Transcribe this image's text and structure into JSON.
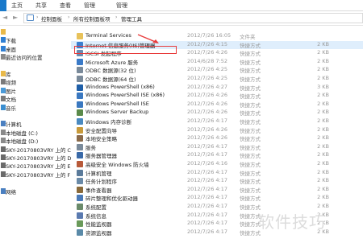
{
  "ribbon": {
    "tabs": [
      "主页",
      "共享",
      "查看",
      "管理",
      "管理"
    ]
  },
  "address": {
    "crumbs": [
      "控制面板",
      "所有控制面板项",
      "管理工具"
    ]
  },
  "nav": [
    {
      "label": "",
      "icon": "star",
      "color": "#e9b949"
    },
    {
      "label": "下载",
      "icon": "download",
      "color": "#2f7fd3"
    },
    {
      "label": "桌面",
      "icon": "desktop",
      "color": "#2f7fd3"
    },
    {
      "label": "最近访问的位置",
      "icon": "recent",
      "color": "#8a8a8a"
    },
    {
      "label": "",
      "icon": "",
      "color": ""
    },
    {
      "label": "库",
      "icon": "library",
      "color": "#e9b949"
    },
    {
      "label": "视频",
      "icon": "video",
      "color": "#7a7a7a"
    },
    {
      "label": "图片",
      "icon": "picture",
      "color": "#4a9ad8"
    },
    {
      "label": "文档",
      "icon": "document",
      "color": "#7a7a7a"
    },
    {
      "label": "音乐",
      "icon": "music",
      "color": "#3a8ed0"
    },
    {
      "label": "",
      "icon": "",
      "color": ""
    },
    {
      "label": "计算机",
      "icon": "computer",
      "color": "#4a7fc0"
    },
    {
      "label": "本地磁盘 (C:)",
      "icon": "drive",
      "color": "#8a8a8a"
    },
    {
      "label": "本地磁盘 (D:)",
      "icon": "drive",
      "color": "#8a8a8a"
    },
    {
      "label": "SKY-20170803VRY 上的 C",
      "icon": "network-drive",
      "color": "#6a6a6a"
    },
    {
      "label": "SKY-20170803VRY 上的 D",
      "icon": "network-drive",
      "color": "#6a6a6a"
    },
    {
      "label": "SKY-20170803VRY 上的 E",
      "icon": "network-drive",
      "color": "#6a6a6a"
    },
    {
      "label": "SKY-20170803VRY 上的 F",
      "icon": "network-drive",
      "color": "#6a6a6a"
    },
    {
      "label": "",
      "icon": "",
      "color": ""
    },
    {
      "label": "网络",
      "icon": "network",
      "color": "#4a7fc0"
    }
  ],
  "files": [
    {
      "name": "Terminal Services",
      "date": "2012/7/26 16:05",
      "type": "文件夹",
      "size": "",
      "icon": "folder",
      "color": "#e8c25a"
    },
    {
      "name": "Internet 信息服务(IIS)管理器",
      "date": "2012/7/26 4:15",
      "type": "快捷方式",
      "size": "2 KB",
      "icon": "iis",
      "color": "#3b7fd0",
      "selected": true
    },
    {
      "name": "iSCSI 发起程序",
      "date": "2012/7/26 4:26",
      "type": "快捷方式",
      "size": "2 KB",
      "icon": "iscsi",
      "color": "#6a8ab0"
    },
    {
      "name": "Microsoft Azure 服务",
      "date": "2014/6/28 7:52",
      "type": "快捷方式",
      "size": "2 KB",
      "icon": "azure",
      "color": "#3a7ac8"
    },
    {
      "name": "ODBC 数据源(32 位)",
      "date": "2012/7/26 4:25",
      "type": "快捷方式",
      "size": "2 KB",
      "icon": "odbc",
      "color": "#7a8a9a"
    },
    {
      "name": "ODBC 数据源(64 位)",
      "date": "2012/7/26 4:25",
      "type": "快捷方式",
      "size": "2 KB",
      "icon": "odbc",
      "color": "#7a8a9a"
    },
    {
      "name": "Windows PowerShell (x86)",
      "date": "2012/7/26 4:27",
      "type": "快捷方式",
      "size": "3 KB",
      "icon": "powershell",
      "color": "#1f5fa8"
    },
    {
      "name": "Windows PowerShell ISE (x86)",
      "date": "2012/7/26 4:26",
      "type": "快捷方式",
      "size": "2 KB",
      "icon": "powershell-ise",
      "color": "#3a78c0"
    },
    {
      "name": "Windows PowerShell ISE",
      "date": "2012/7/26 4:26",
      "type": "快捷方式",
      "size": "2 KB",
      "icon": "powershell-ise",
      "color": "#3a78c0"
    },
    {
      "name": "Windows Server Backup",
      "date": "2012/7/26 4:26",
      "type": "快捷方式",
      "size": "2 KB",
      "icon": "backup",
      "color": "#5a8a4a"
    },
    {
      "name": "Windows 内存诊断",
      "date": "2012/7/26 4:17",
      "type": "快捷方式",
      "size": "2 KB",
      "icon": "memory",
      "color": "#4a8ac0"
    },
    {
      "name": "安全配置向导",
      "date": "2012/7/26 4:26",
      "type": "快捷方式",
      "size": "2 KB",
      "icon": "security",
      "color": "#c89a3a"
    },
    {
      "name": "本地安全策略",
      "date": "2012/7/26 4:26",
      "type": "快捷方式",
      "size": "2 KB",
      "icon": "policy",
      "color": "#8a6a4a"
    },
    {
      "name": "服务",
      "date": "2012/7/26 4:17",
      "type": "快捷方式",
      "size": "2 KB",
      "icon": "services",
      "color": "#7a8a9a"
    },
    {
      "name": "服务器管理器",
      "date": "2012/7/26 4:17",
      "type": "快捷方式",
      "size": "2 KB",
      "icon": "server-manager",
      "color": "#3a6aa8"
    },
    {
      "name": "高级安全 Windows 防火墙",
      "date": "2012/7/26 4:16",
      "type": "快捷方式",
      "size": "2 KB",
      "icon": "firewall",
      "color": "#b85a3a"
    },
    {
      "name": "计算机管理",
      "date": "2012/7/26 4:17",
      "type": "快捷方式",
      "size": "2 KB",
      "icon": "computer-management",
      "color": "#5a7a9a"
    },
    {
      "name": "任务计划程序",
      "date": "2012/7/26 4:17",
      "type": "快捷方式",
      "size": "2 KB",
      "icon": "task-scheduler",
      "color": "#6a8aa8"
    },
    {
      "name": "事件查看器",
      "date": "2012/7/26 4:17",
      "type": "快捷方式",
      "size": "2 KB",
      "icon": "event-viewer",
      "color": "#8a6a3a"
    },
    {
      "name": "碎片整理和优化驱动器",
      "date": "2012/7/26 4:17",
      "type": "快捷方式",
      "size": "2 KB",
      "icon": "defrag",
      "color": "#4a7ab8"
    },
    {
      "name": "系统配置",
      "date": "2012/7/26 4:17",
      "type": "快捷方式",
      "size": "2 KB",
      "icon": "system-config",
      "color": "#6a8a6a"
    },
    {
      "name": "系统信息",
      "date": "2012/7/26 4:17",
      "type": "快捷方式",
      "size": "2 KB",
      "icon": "system-info",
      "color": "#5a7ab0"
    },
    {
      "name": "性能监视器",
      "date": "2012/7/26 4:17",
      "type": "快捷方式",
      "size": "2 KB",
      "icon": "perf-monitor",
      "color": "#6a9a5a"
    },
    {
      "name": "资源监视器",
      "date": "2012/7/26 4:17",
      "type": "快捷方式",
      "size": "2 KB",
      "icon": "resource-monitor",
      "color": "#5a8aa8"
    }
  ],
  "watermark": "软件技巧",
  "colors": {
    "selection": "#dfeefc",
    "annotation": "#e83b3b"
  }
}
